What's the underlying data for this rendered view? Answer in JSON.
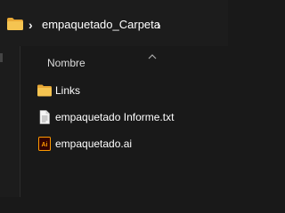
{
  "breadcrumb": {
    "current_folder": "empaquetado_Carpeta"
  },
  "file_list": {
    "column_header": "Nombre",
    "items": [
      {
        "name": "Links",
        "icon": "folder-icon"
      },
      {
        "name": "empaquetado Informe.txt",
        "icon": "text-file-icon"
      },
      {
        "name": "empaquetado.ai",
        "icon": "illustrator-file-icon"
      }
    ]
  },
  "colors": {
    "background": "#191919",
    "folder_yellow": "#f2c14e",
    "illustrator_orange": "#ff9a00",
    "illustrator_bg": "#330000"
  }
}
